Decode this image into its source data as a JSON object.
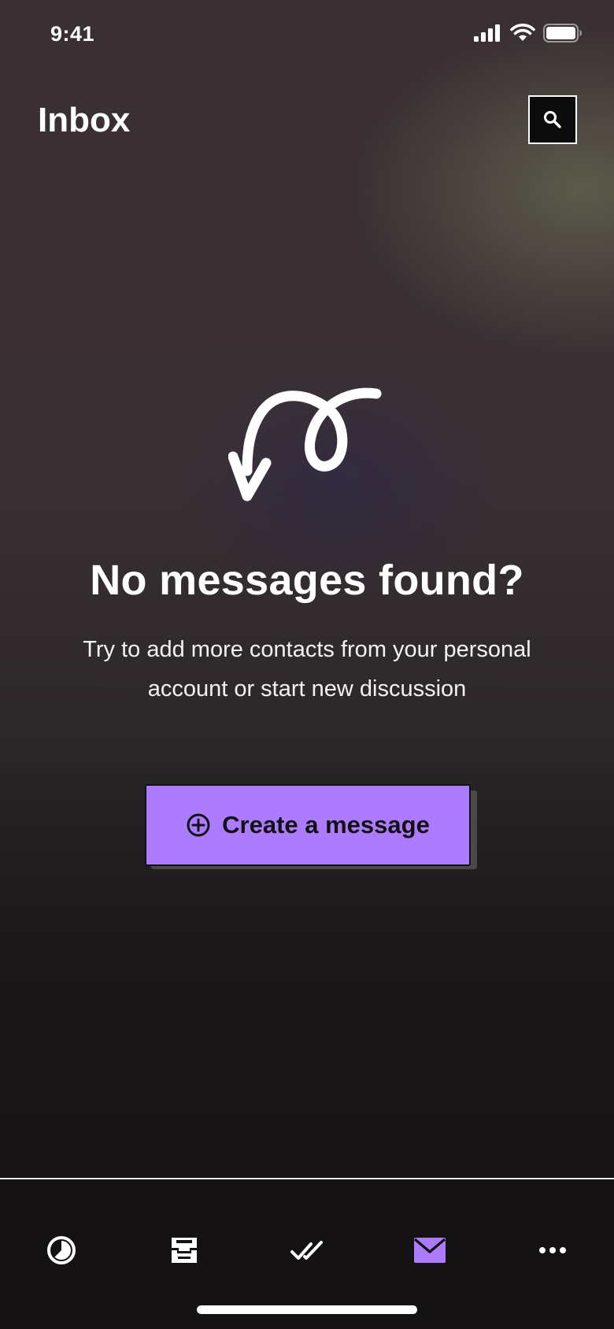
{
  "status_bar": {
    "time": "9:41",
    "icons": [
      "cellular-signal-icon",
      "wifi-icon",
      "battery-icon"
    ]
  },
  "header": {
    "title": "Inbox",
    "search_icon": "search-icon"
  },
  "empty_state": {
    "illustration": "curly-arrow-illustration",
    "title": "No messages found?",
    "description": "Try to add more contacts from your personal account or start new discussion",
    "cta": {
      "label": "Create a message",
      "icon": "plus-circle-icon"
    }
  },
  "tab_bar": {
    "items": [
      {
        "icon": "clock-icon",
        "active": false
      },
      {
        "icon": "archive-icon",
        "active": false
      },
      {
        "icon": "double-check-icon",
        "active": false
      },
      {
        "icon": "mail-icon",
        "active": true
      },
      {
        "icon": "more-icon",
        "active": false
      }
    ]
  },
  "colors": {
    "accent": "#ad7bff",
    "background": "#161414",
    "text": "#ffffff",
    "button_shadow": "#4a4848"
  }
}
